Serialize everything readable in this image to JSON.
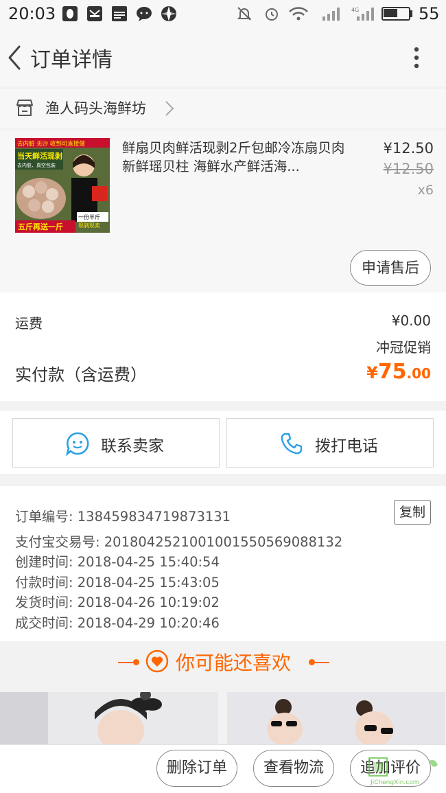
{
  "status_bar": {
    "time": "20:03",
    "battery_percent": "55",
    "battery_level": 0.55,
    "network": "4G",
    "icons": [
      "qq-icon",
      "mail-icon",
      "news-icon",
      "chat-icon",
      "browser-icon",
      "mute-icon",
      "alarm-icon",
      "wifi-icon",
      "signal-icon",
      "signal-4g-icon",
      "battery-icon"
    ],
    "news_badge": "NEWS"
  },
  "header": {
    "title": "订单详情"
  },
  "store": {
    "name": "渔人码头海鲜坊"
  },
  "product": {
    "title": "鲜扇贝肉鲜活现剥2斤包邮冷冻扇贝肉新鲜瑶贝柱 海鲜水产鲜活海...",
    "price": "¥12.50",
    "original_price": "¥12.50",
    "quantity": "x6",
    "thumb_texts": {
      "top": "去内脏 无沙 收到可直接做",
      "mid": "当天鲜活现剥",
      "sub": "去内脏、真空包装",
      "badge": "一份半斤",
      "sig": "现剥现卖",
      "bottom": "五斤再送一斤"
    },
    "aftersale_label": "申请售后"
  },
  "totals": {
    "shipping_label": "运费",
    "shipping_value": "¥0.00",
    "promo": "冲冠促销",
    "paid_label": "实付款（含运费）",
    "paid_currency": "¥",
    "paid_integer": "75",
    "paid_decimal": ".00"
  },
  "contact": {
    "seller_label": "联系卖家",
    "call_label": "拨打电话"
  },
  "order_info": {
    "lines": [
      "订单编号: 1384598347198731​31",
      "支付宝交易号: 2018042521001001550569088132",
      "创建时间: 2018-04-25 15:40:54",
      "付款时间: 2018-04-25 15:43:05",
      "发货时间: 2018-04-26 10:19:02",
      "成交时间: 2018-04-29 10:20:46"
    ],
    "copy_label": "复制"
  },
  "recommend": {
    "title": "你可能还喜欢"
  },
  "bottom_bar": {
    "delete_label": "删除订单",
    "logistics_label": "查看物流",
    "review_label": "追加评价"
  },
  "watermark": {
    "text": "JiChengXin.com"
  },
  "colors": {
    "accent": "#ff6600",
    "blue_icon": "#2aa0e6",
    "background": "#f2f2f2"
  }
}
